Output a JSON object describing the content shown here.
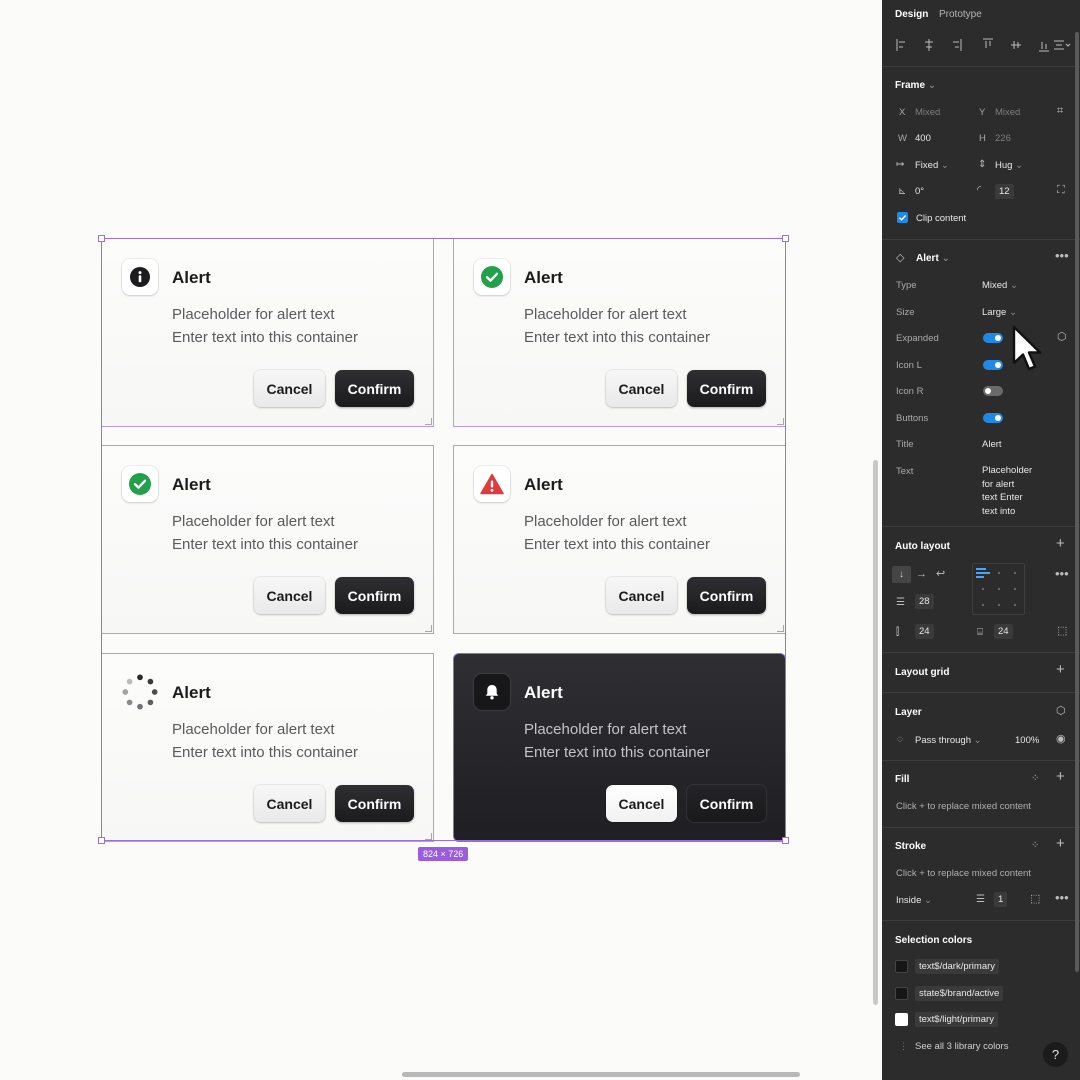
{
  "canvas": {
    "selection_size": "824 × 726",
    "cards": [
      {
        "icon": "info-icon",
        "title": "Alert",
        "text1": "Placeholder for alert text",
        "text2": "Enter text into this container",
        "cancel": "Cancel",
        "confirm": "Confirm"
      },
      {
        "icon": "success-check-icon",
        "title": "Alert",
        "text1": "Placeholder for alert text",
        "text2": "Enter text into this container",
        "cancel": "Cancel",
        "confirm": "Confirm"
      },
      {
        "icon": "success-check-icon",
        "title": "Alert",
        "text1": "Placeholder for alert text",
        "text2": "Enter text into this container",
        "cancel": "Cancel",
        "confirm": "Confirm"
      },
      {
        "icon": "warning-triangle-icon",
        "title": "Alert",
        "text1": "Placeholder for alert text",
        "text2": "Enter text into this container",
        "cancel": "Cancel",
        "confirm": "Confirm"
      },
      {
        "icon": "loading-spinner-icon",
        "title": "Alert",
        "text1": "Placeholder for alert text",
        "text2": "Enter text into this container",
        "cancel": "Cancel",
        "confirm": "Confirm"
      },
      {
        "icon": "bell-icon",
        "title": "Alert",
        "text1": "Placeholder for alert text",
        "text2": "Enter text into this container",
        "cancel": "Cancel",
        "confirm": "Confirm"
      }
    ],
    "colors": {
      "success": "#22a14a",
      "warning": "#e03b3b",
      "dark_card": "#242428",
      "selection": "#9b6fd6"
    }
  },
  "panel": {
    "tabs": {
      "design": "Design",
      "prototype": "Prototype"
    },
    "frame": {
      "title": "Frame",
      "x_label": "X",
      "x_value": "Mixed",
      "y_label": "Y",
      "y_value": "Mixed",
      "w_label": "W",
      "w_value": "400",
      "h_label": "H",
      "h_value": "226",
      "width_mode": "Fixed",
      "height_mode": "Hug",
      "rotation": "0°",
      "radius": "12",
      "clip_content": "Clip content"
    },
    "component": {
      "title": "Alert",
      "props": {
        "type_label": "Type",
        "type_value": "Mixed",
        "size_label": "Size",
        "size_value": "Large",
        "expanded_label": "Expanded",
        "expanded": true,
        "icon_l_label": "Icon L",
        "icon_l": true,
        "icon_r_label": "Icon R",
        "icon_r": false,
        "buttons_label": "Buttons",
        "buttons": true,
        "title_label": "Title",
        "title_value": "Alert",
        "text_label": "Text",
        "text_lines": [
          "Placeholder",
          "for alert",
          "text Enter",
          "text into"
        ]
      }
    },
    "auto_layout": {
      "title": "Auto layout",
      "gap": "28",
      "padding_h": "24",
      "padding_v": "24"
    },
    "layout_grid": {
      "title": "Layout grid"
    },
    "layer": {
      "title": "Layer",
      "blend": "Pass through",
      "opacity": "100%"
    },
    "fill": {
      "title": "Fill",
      "hint": "Click + to replace mixed content"
    },
    "stroke": {
      "title": "Stroke",
      "hint": "Click + to replace mixed content",
      "position": "Inside",
      "weight": "1"
    },
    "selection_colors": {
      "title": "Selection colors",
      "items": [
        {
          "name": "text$/dark/primary",
          "color": "#161616"
        },
        {
          "name": "state$/brand/active",
          "color": "#161616"
        },
        {
          "name": "text$/light/primary",
          "color": "#ffffff"
        }
      ],
      "see_all": "See all 3 library colors"
    },
    "help": "?"
  }
}
